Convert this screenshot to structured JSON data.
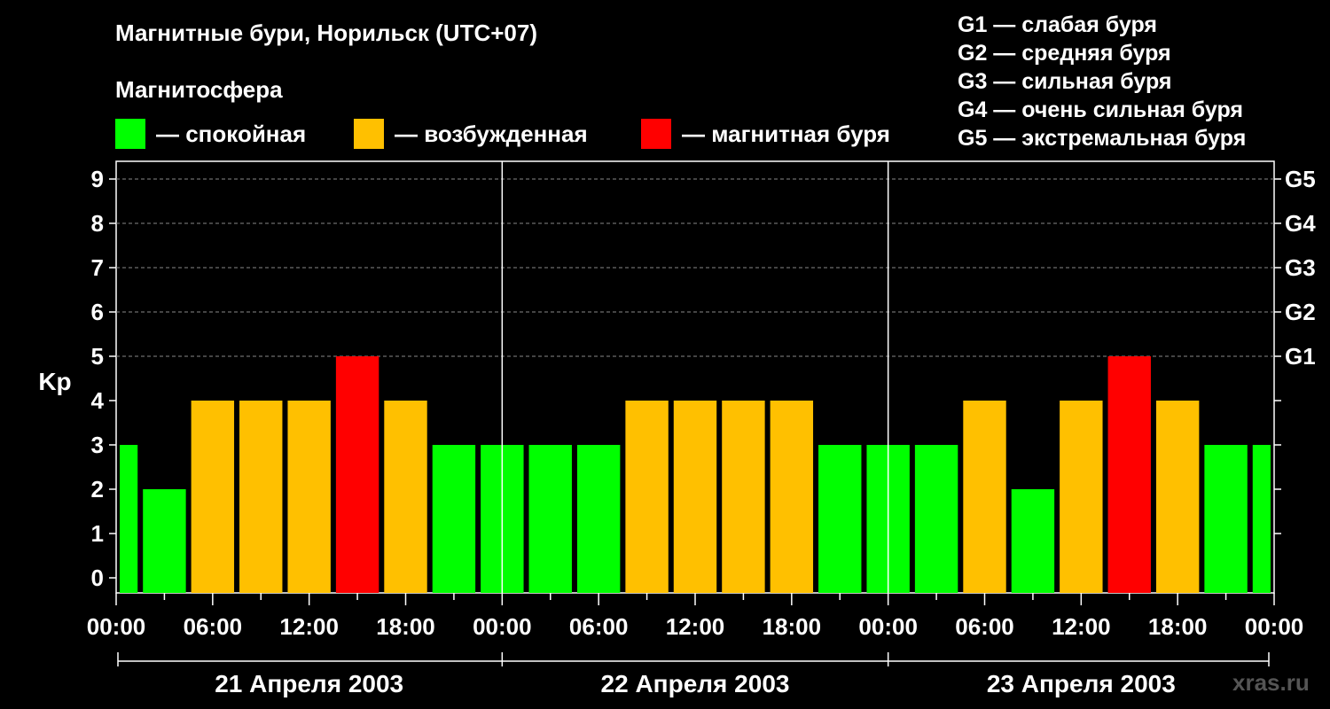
{
  "title": "Магнитные бури, Норильск (UTC+07)",
  "magnetosphere": {
    "title": "Магнитосфера",
    "items": [
      {
        "label": "— спокойная",
        "color": "#00ff00"
      },
      {
        "label": "— возбужденная",
        "color": "#ffc000"
      },
      {
        "label": "— магнитная буря",
        "color": "#ff0000"
      }
    ]
  },
  "storm_legend": [
    "G1 — слабая буря",
    "G2 — средняя буря",
    "G3 — сильная буря",
    "G4 — очень сильная буря",
    "G5 — экстремальная буря"
  ],
  "watermark": "xras.ru",
  "chart_data": {
    "type": "bar",
    "ylabel": "Kp",
    "ylim": [
      0,
      9
    ],
    "yticks": [
      "0",
      "1",
      "2",
      "3",
      "4",
      "5",
      "6",
      "7",
      "8",
      "9"
    ],
    "right_ticks": [
      {
        "value": 5,
        "label": "G1"
      },
      {
        "value": 6,
        "label": "G2"
      },
      {
        "value": 7,
        "label": "G3"
      },
      {
        "value": 8,
        "label": "G4"
      },
      {
        "value": 9,
        "label": "G5"
      }
    ],
    "xticks": [
      "00:00",
      "06:00",
      "12:00",
      "18:00",
      "00:00",
      "06:00",
      "12:00",
      "18:00",
      "00:00",
      "06:00",
      "12:00",
      "18:00",
      "00:00"
    ],
    "days": [
      "21 Апреля 2003",
      "22 Апреля 2003",
      "23 Апреля 2003"
    ],
    "grid": true,
    "colors": {
      "quiet": "#00ff00",
      "active": "#ffc000",
      "storm": "#ff0000"
    },
    "values": [
      3,
      2,
      4,
      4,
      4,
      5,
      4,
      3,
      3,
      3,
      3,
      4,
      4,
      4,
      4,
      3,
      3,
      3,
      4,
      2,
      4,
      5,
      4,
      3,
      3
    ]
  }
}
